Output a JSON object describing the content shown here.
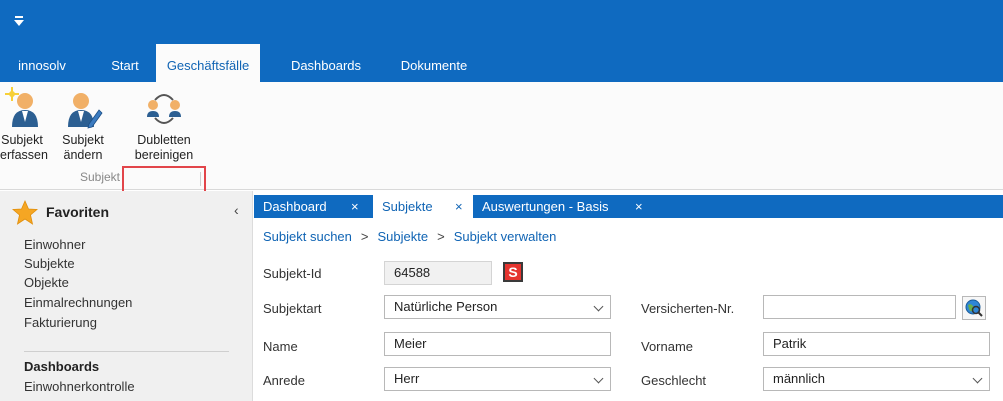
{
  "ribbon": {
    "tabs": [
      {
        "label": "innosolv",
        "active": false
      },
      {
        "label": "Start",
        "active": false
      },
      {
        "label": "Geschäftsfälle",
        "active": true
      },
      {
        "label": "Dashboards",
        "active": false
      },
      {
        "label": "Dokumente",
        "active": false
      }
    ],
    "buttons": [
      {
        "line1": "Subjekt",
        "line2": "erfassen",
        "icon": "person-add-icon"
      },
      {
        "line1": "Subjekt",
        "line2": "ändern",
        "icon": "person-edit-icon"
      },
      {
        "line1": "Dubletten",
        "line2": "bereinigen",
        "icon": "merge-persons-icon"
      }
    ],
    "group_label": "Subjekt"
  },
  "sidebar": {
    "title": "Favoriten",
    "collapse_glyph": "‹",
    "items": [
      "Einwohner",
      "Subjekte",
      "Objekte",
      "Einmalrechnungen",
      "Fakturierung"
    ],
    "dashboards_heading": "Dashboards",
    "dashboard_items": [
      "Einwohnerkontrolle"
    ]
  },
  "doc_tabs": [
    {
      "label": "Dashboard",
      "close": "×",
      "active": false
    },
    {
      "label": "Subjekte",
      "close": "×",
      "active": true
    },
    {
      "label": "Auswertungen - Basis",
      "close": "×",
      "active": false
    }
  ],
  "breadcrumb": {
    "items": [
      "Subjekt suchen",
      "Subjekte",
      "Subjekt verwalten"
    ],
    "separator": ">"
  },
  "form": {
    "subjekt_id": {
      "label": "Subjekt-Id",
      "value": "64588"
    },
    "s_button": "S",
    "subjektart": {
      "label": "Subjektart",
      "value": "Natürliche Person"
    },
    "versicherten_nr": {
      "label": "Versicherten-Nr.",
      "value": ""
    },
    "name": {
      "label": "Name",
      "value": "Meier"
    },
    "vorname": {
      "label": "Vorname",
      "value": "Patrik"
    },
    "anrede": {
      "label": "Anrede",
      "value": "Herr"
    },
    "geschlecht": {
      "label": "Geschlecht",
      "value": "männlich"
    }
  },
  "colors": {
    "accent": "#0f6ac0",
    "highlight": "#e2454a",
    "link": "#1064b4"
  }
}
